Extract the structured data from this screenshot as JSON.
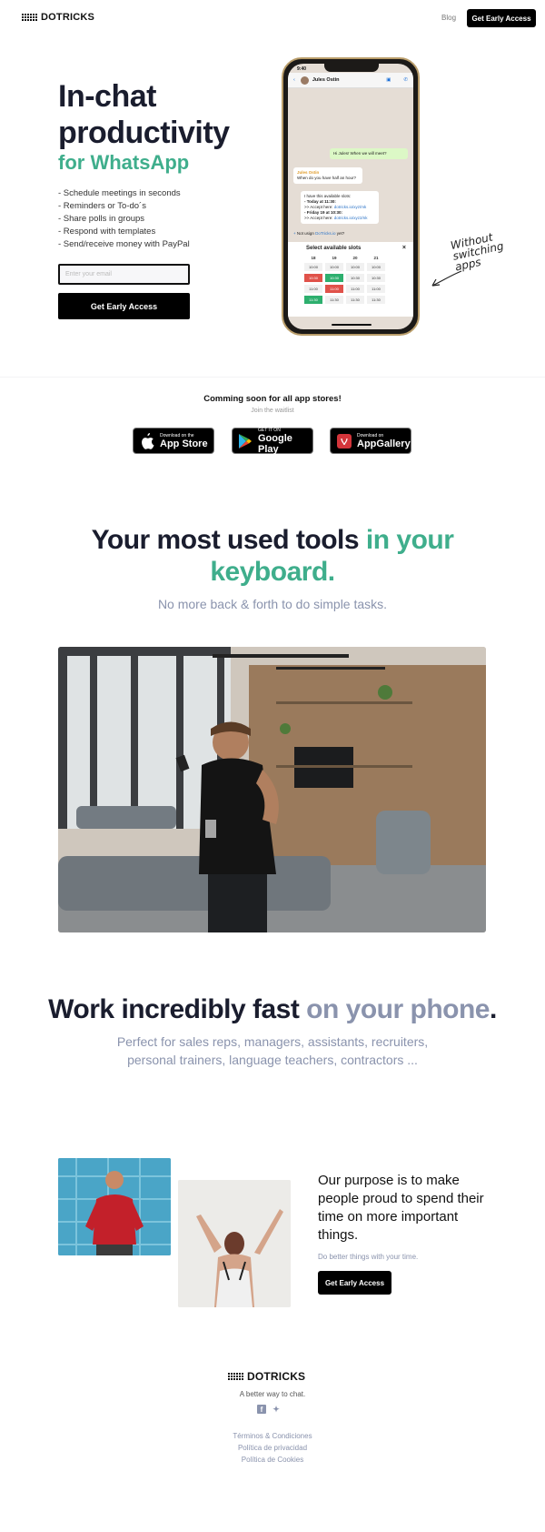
{
  "nav": {
    "logo_text": "DOTRICKS",
    "blog_label": "Blog",
    "cta_label": "Get Early Access"
  },
  "hero": {
    "title_line1": "In-chat",
    "title_line2": "productivity",
    "subtitle": "for WhatsApp",
    "features": [
      "- Schedule meetings in seconds",
      "- Reminders or To-do´s",
      "- Share polls in groups",
      "- Respond with templates",
      "- Send/receive money with PayPal"
    ],
    "email_placeholder": "Enter your email",
    "cta_label": "Get Early Access",
    "annotation_line1": "Without",
    "annotation_line2": "switching",
    "annotation_line3": "apps"
  },
  "phone": {
    "time": "9:40",
    "contact_name": "Jules Ostin",
    "msg_out": "Hi Jules! When we will meet?",
    "msg_in1_sender": "Jules Ostin",
    "msg_in1_text": "When do you have half an hour?",
    "msg_in2_line1": "I have this available slots:",
    "msg_in2_line2": "- Today at 11:30:",
    "msg_in2_line3": ">> Accept here:",
    "msg_in2_link1": "dotricks.io/xyz/mk",
    "msg_in2_line4": "- Friday 19 at 10:30:",
    "msg_in2_link2": "dotricks.io/xyz2/nk",
    "input_prefix": "Not usign",
    "input_link": "DoTricks.io",
    "input_suffix": "yet?",
    "slots_title": "Select available slots",
    "slot_days": [
      "18",
      "19",
      "20",
      "21"
    ],
    "slot_rows": [
      [
        "10:00",
        "10:00",
        "10:00",
        "10:00"
      ],
      [
        "10:30",
        "10:30",
        "10:30",
        "10:30"
      ],
      [
        "11:00",
        "11:00",
        "11:00",
        "11:00"
      ],
      [
        "11:30",
        "11:30",
        "11:30",
        "11:30"
      ]
    ]
  },
  "stores": {
    "heading": "Comming soon for all app stores!",
    "waitlist": "Join the waitlist",
    "apple_small": "Download on the",
    "apple_big": "App Store",
    "google_small": "GET IT ON",
    "google_big": "Google Play",
    "huawei_small": "Download on",
    "huawei_big": "AppGallery"
  },
  "tools": {
    "title_part1": "Your most used tools",
    "title_part2": " in your",
    "title_part3": "keyboard.",
    "subtitle": "No more back & forth to do simple tasks."
  },
  "fast": {
    "title_part1": "Work incredibly fast",
    "title_part2": " on your phone",
    "title_part3": ".",
    "subtitle": "Perfect for sales reps, managers, assistants, recruiters, personal trainers, language teachers, contractors ..."
  },
  "purpose": {
    "text": "Our purpose is to make people proud to spend their time on more important things.",
    "sub": "Do better things with your time.",
    "cta_label": "Get Early Access"
  },
  "footer": {
    "logo_text": "DOTRICKS",
    "tagline": "A better way to chat.",
    "links": [
      "Términos & Condiciones",
      "Política de privacidad",
      "Política de Cookies"
    ]
  },
  "colors": {
    "accent_green": "#3fae8c",
    "muted_blue": "#8a93ad",
    "dark": "#1a1d2e"
  }
}
